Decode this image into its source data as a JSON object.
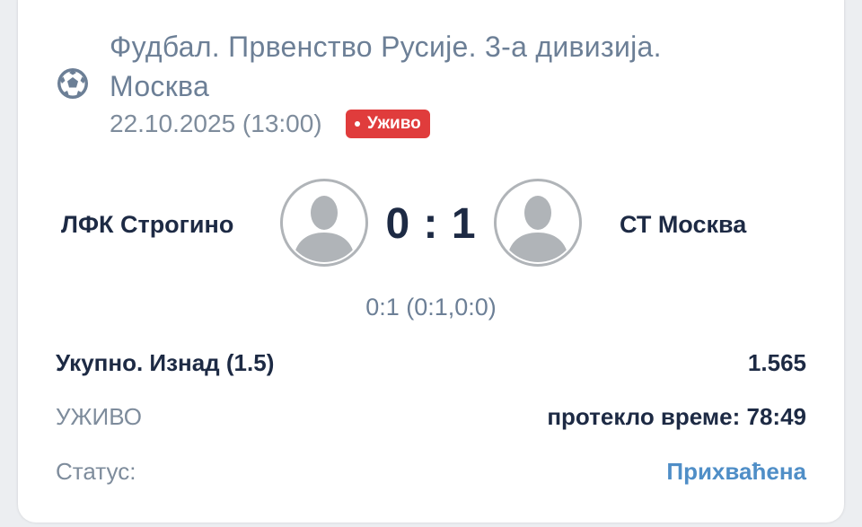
{
  "league": {
    "title": "Фудбал. Првенство Русије. 3-а дивизија. Москва",
    "sport_icon": "soccer-ball-icon"
  },
  "match": {
    "datetime": "22.10.2025 (13:00)",
    "live_badge": "Уживо",
    "home_team": "ЛФК Строгино",
    "away_team": "СТ Москва",
    "score": "0 : 1",
    "score_detail": "0:1 (0:1,0:0)",
    "team_avatar_icon": "user-placeholder-icon"
  },
  "bet": {
    "market": "Укупно. Изнад (1.5)",
    "odds": "1.565",
    "live_label": "УЖИВО",
    "elapsed_time": "протекло време: 78:49",
    "status_label": "Статус:",
    "status_value": "Прихваћена"
  },
  "colors": {
    "primary_text": "#1d2a44",
    "secondary_text": "#6c7f96",
    "live_badge": "#e03c3c",
    "accepted_status": "#4f8ec7",
    "avatar_bg": "#b0b4b8"
  }
}
